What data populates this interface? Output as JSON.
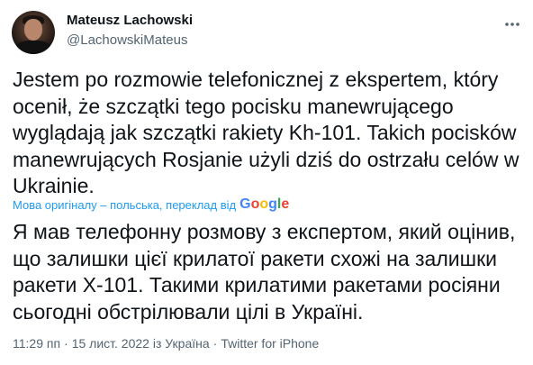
{
  "author": {
    "display_name": "Mateusz Lachowski",
    "handle": "@LachowskiMateus"
  },
  "tweet": {
    "text": "Jestem po rozmowie telefonicznej z ekspertem, który ocenił, że szczątki tego pocisku manewrującego wyglądają jak szczątki rakiety Kh-101. Takich pocisków manewrujących Rosjanie użyli dziś do ostrzału celów w Ukrainie.",
    "translation_label": "Мова оригіналу – польська, переклад від",
    "translation_provider": "Google",
    "translated_text": "Я мав телефонну розмову з експертом, який оцінив, що залишки цієї крилатої ракети схожі на залишки ракети Х-101. Такими крилатими ракетами росіяни сьогодні обстрілювали цілі в Україні."
  },
  "meta": {
    "time": "11:29 пп",
    "separator": "·",
    "date": "15 лист. 2022 із Україна",
    "source": "Twitter for iPhone"
  },
  "icons": {
    "avatar": "profile-photo",
    "more": "more-dots-icon"
  },
  "colors": {
    "text": "#0f1419",
    "secondary": "#536471",
    "link": "#1d9bf0",
    "google_blue": "#4285F4",
    "google_red": "#EA4335",
    "google_yellow": "#FBBC05",
    "google_green": "#34A853"
  }
}
